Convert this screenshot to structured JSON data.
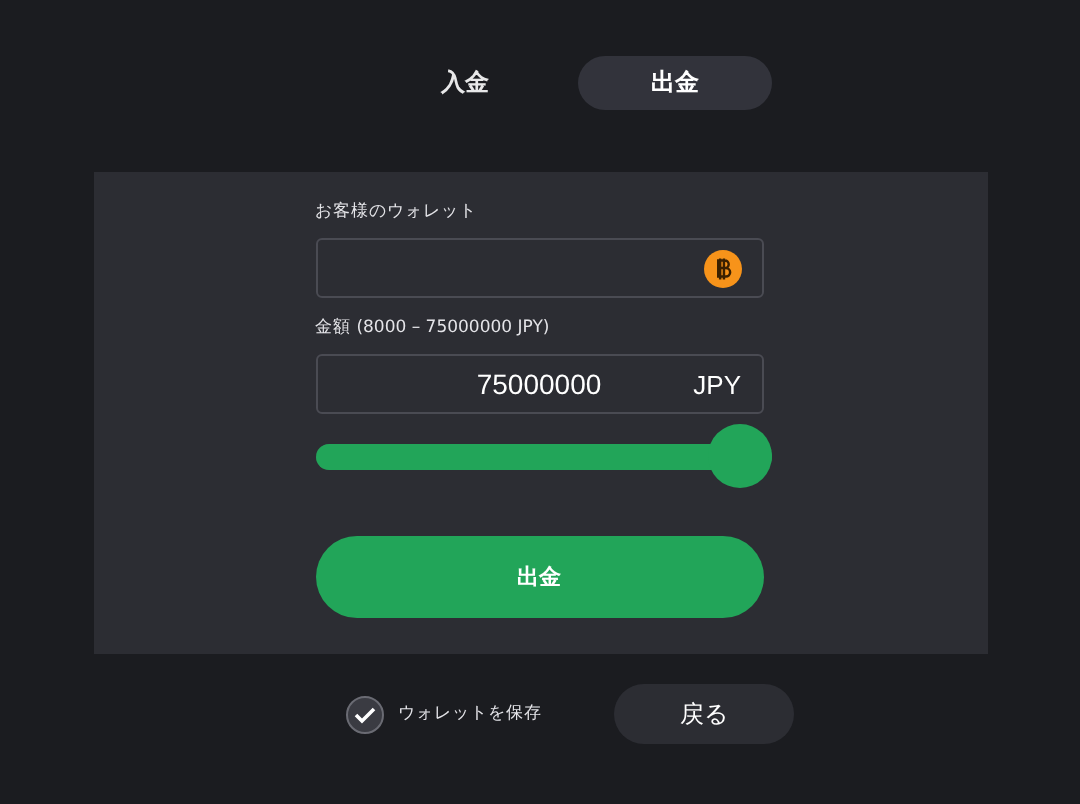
{
  "tabs": [
    {
      "label": "入金",
      "selected": false
    },
    {
      "label": "出金",
      "selected": true
    }
  ],
  "wallet": {
    "label": "お客様のウォレット"
  },
  "amount": {
    "label": "金額 (8000 – 75000000 JPY)",
    "value": "75000000",
    "currency": "JPY"
  },
  "slider": {
    "level": 1
  },
  "submit": {
    "label": "出金"
  },
  "save_wallet": {
    "label": "ウォレットを保存",
    "checked": true
  },
  "back": {
    "label": "戻る"
  }
}
